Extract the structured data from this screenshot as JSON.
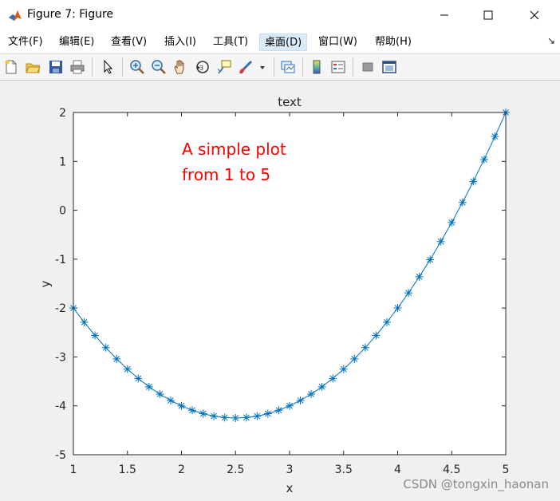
{
  "window": {
    "title": "Figure 7: Figure"
  },
  "menu": {
    "items": [
      "文件(F)",
      "编辑(E)",
      "查看(V)",
      "插入(I)",
      "工具(T)",
      "桌面(D)",
      "窗口(W)",
      "帮助(H)"
    ],
    "active": "桌面(D)"
  },
  "toolbar": {
    "icons": [
      "new-figure-icon",
      "open-file-icon",
      "save-icon",
      "print-icon",
      "select-arrow-icon",
      "zoom-in-icon",
      "zoom-out-icon",
      "pan-hand-icon",
      "rotate-3d-icon",
      "data-cursor-icon",
      "brush-icon",
      "link-plot-icon",
      "colorbar-icon",
      "legend-icon",
      "hide-plot-tools-icon",
      "show-plot-tools-icon"
    ]
  },
  "colors": {
    "line": "#0072bd",
    "annotation": "#ff0000",
    "axes": "#262626"
  },
  "chart_data": {
    "type": "line",
    "title": "text",
    "xlabel": "x",
    "ylabel": "y",
    "xlim": [
      1,
      5
    ],
    "ylim": [
      -5,
      2
    ],
    "xticks": [
      "1",
      "1.5",
      "2",
      "2.5",
      "3",
      "3.5",
      "4",
      "4.5",
      "5"
    ],
    "yticks": [
      "2",
      "1",
      "0",
      "-1",
      "-2",
      "-3",
      "-4",
      "-5"
    ],
    "marker": "*",
    "grid": false,
    "annotation": [
      "A simple plot",
      "from 1 to 5"
    ],
    "x": [
      1,
      1.1,
      1.2,
      1.3,
      1.4,
      1.5,
      1.6,
      1.7,
      1.8,
      1.9,
      2,
      2.1,
      2.2,
      2.3,
      2.4,
      2.5,
      2.6,
      2.7,
      2.8,
      2.9,
      3,
      3.1,
      3.2,
      3.3,
      3.4,
      3.5,
      3.6,
      3.7,
      3.8,
      3.9,
      4,
      4.1,
      4.2,
      4.3,
      4.4,
      4.5,
      4.6,
      4.7,
      4.8,
      4.9,
      5
    ],
    "y": [
      -2,
      -2.29,
      -2.56,
      -2.81,
      -3.04,
      -3.25,
      -3.44,
      -3.61,
      -3.76,
      -3.89,
      -4,
      -4.09,
      -4.16,
      -4.21,
      -4.24,
      -4.25,
      -4.24,
      -4.21,
      -4.16,
      -4.09,
      -4,
      -3.89,
      -3.76,
      -3.61,
      -3.44,
      -3.25,
      -3.04,
      -2.81,
      -2.56,
      -2.29,
      -2,
      -1.69,
      -1.36,
      -1.01,
      -0.64,
      -0.25,
      0.16,
      0.59,
      1.04,
      1.51,
      2
    ]
  },
  "watermark": "CSDN @tongxin_haonan"
}
